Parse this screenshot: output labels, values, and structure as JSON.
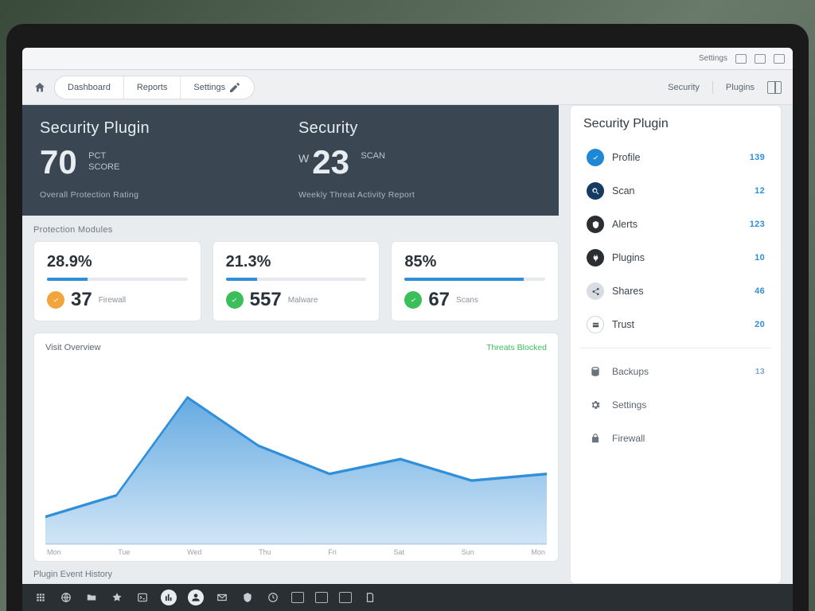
{
  "browser": {
    "url_hint": "",
    "menu_label": "Settings",
    "icons": [
      "window-icon",
      "restore-icon",
      "layout-icon"
    ]
  },
  "header": {
    "home_icon": "home-icon",
    "tabs": [
      {
        "label": "Dashboard"
      },
      {
        "label": "Reports"
      },
      {
        "label": "Settings"
      }
    ],
    "right_links": [
      {
        "label": "Security"
      },
      {
        "label": "Plugins"
      }
    ]
  },
  "hero": {
    "left": {
      "title": "Security Plugin",
      "value": "70",
      "unit_line1": "PCT",
      "unit_line2": "SCORE",
      "subtitle": "Overall Protection Rating"
    },
    "right": {
      "title": "Security",
      "prefix": "W",
      "value": "23",
      "unit": "SCAN",
      "subtitle": "Weekly Threat Activity Report"
    }
  },
  "section_label": "Protection Modules",
  "stats": [
    {
      "pct": "28.9%",
      "progress": 29,
      "dot": "orange",
      "num": "37",
      "cap": "Firewall"
    },
    {
      "pct": "21.3%",
      "progress": 22,
      "dot": "green",
      "num": "557",
      "cap": "Malware"
    },
    {
      "pct": "85%",
      "progress": 85,
      "dot": "green",
      "num": "67",
      "cap": "Scans"
    }
  ],
  "chart": {
    "title": "Visit Overview",
    "legend_right": "Threats Blocked"
  },
  "chart_data": {
    "type": "area",
    "categories": [
      "Mon",
      "Tue",
      "Wed",
      "Thu",
      "Fri",
      "Sat",
      "Sun",
      "Mon"
    ],
    "values": [
      8,
      14,
      42,
      28,
      20,
      24,
      18,
      20
    ],
    "ylim": [
      0,
      50
    ],
    "xlabel": "",
    "ylabel": "",
    "title": "Visit Overview"
  },
  "footer_label": "Plugin Event History",
  "side": {
    "title": "Security Plugin",
    "primary": [
      {
        "icon": "check-icon",
        "color": "blue",
        "name": "Profile",
        "value": "139"
      },
      {
        "icon": "search-icon",
        "color": "navy",
        "name": "Scan",
        "value": "12"
      },
      {
        "icon": "shield-icon",
        "color": "dark",
        "name": "Alerts",
        "value": "123"
      },
      {
        "icon": "plug-icon",
        "color": "dark",
        "name": "Plugins",
        "value": "10"
      },
      {
        "icon": "share-icon",
        "color": "grey",
        "name": "Shares",
        "value": "46"
      },
      {
        "icon": "card-icon",
        "color": "white",
        "name": "Trust",
        "value": "20"
      }
    ],
    "secondary": [
      {
        "icon": "database-icon",
        "name": "Backups",
        "value": "13"
      },
      {
        "icon": "gear-icon",
        "name": "Settings",
        "value": ""
      },
      {
        "icon": "lock-icon",
        "name": "Firewall",
        "value": ""
      }
    ]
  },
  "taskbar": {
    "items": [
      "apps-icon",
      "globe-icon",
      "folder-icon",
      "star-icon",
      "terminal-icon",
      "chart-icon",
      "user-icon",
      "mail-icon",
      "shield-icon",
      "clock-icon",
      "card-icon",
      "grid-icon",
      "window-icon",
      "note-icon"
    ]
  }
}
